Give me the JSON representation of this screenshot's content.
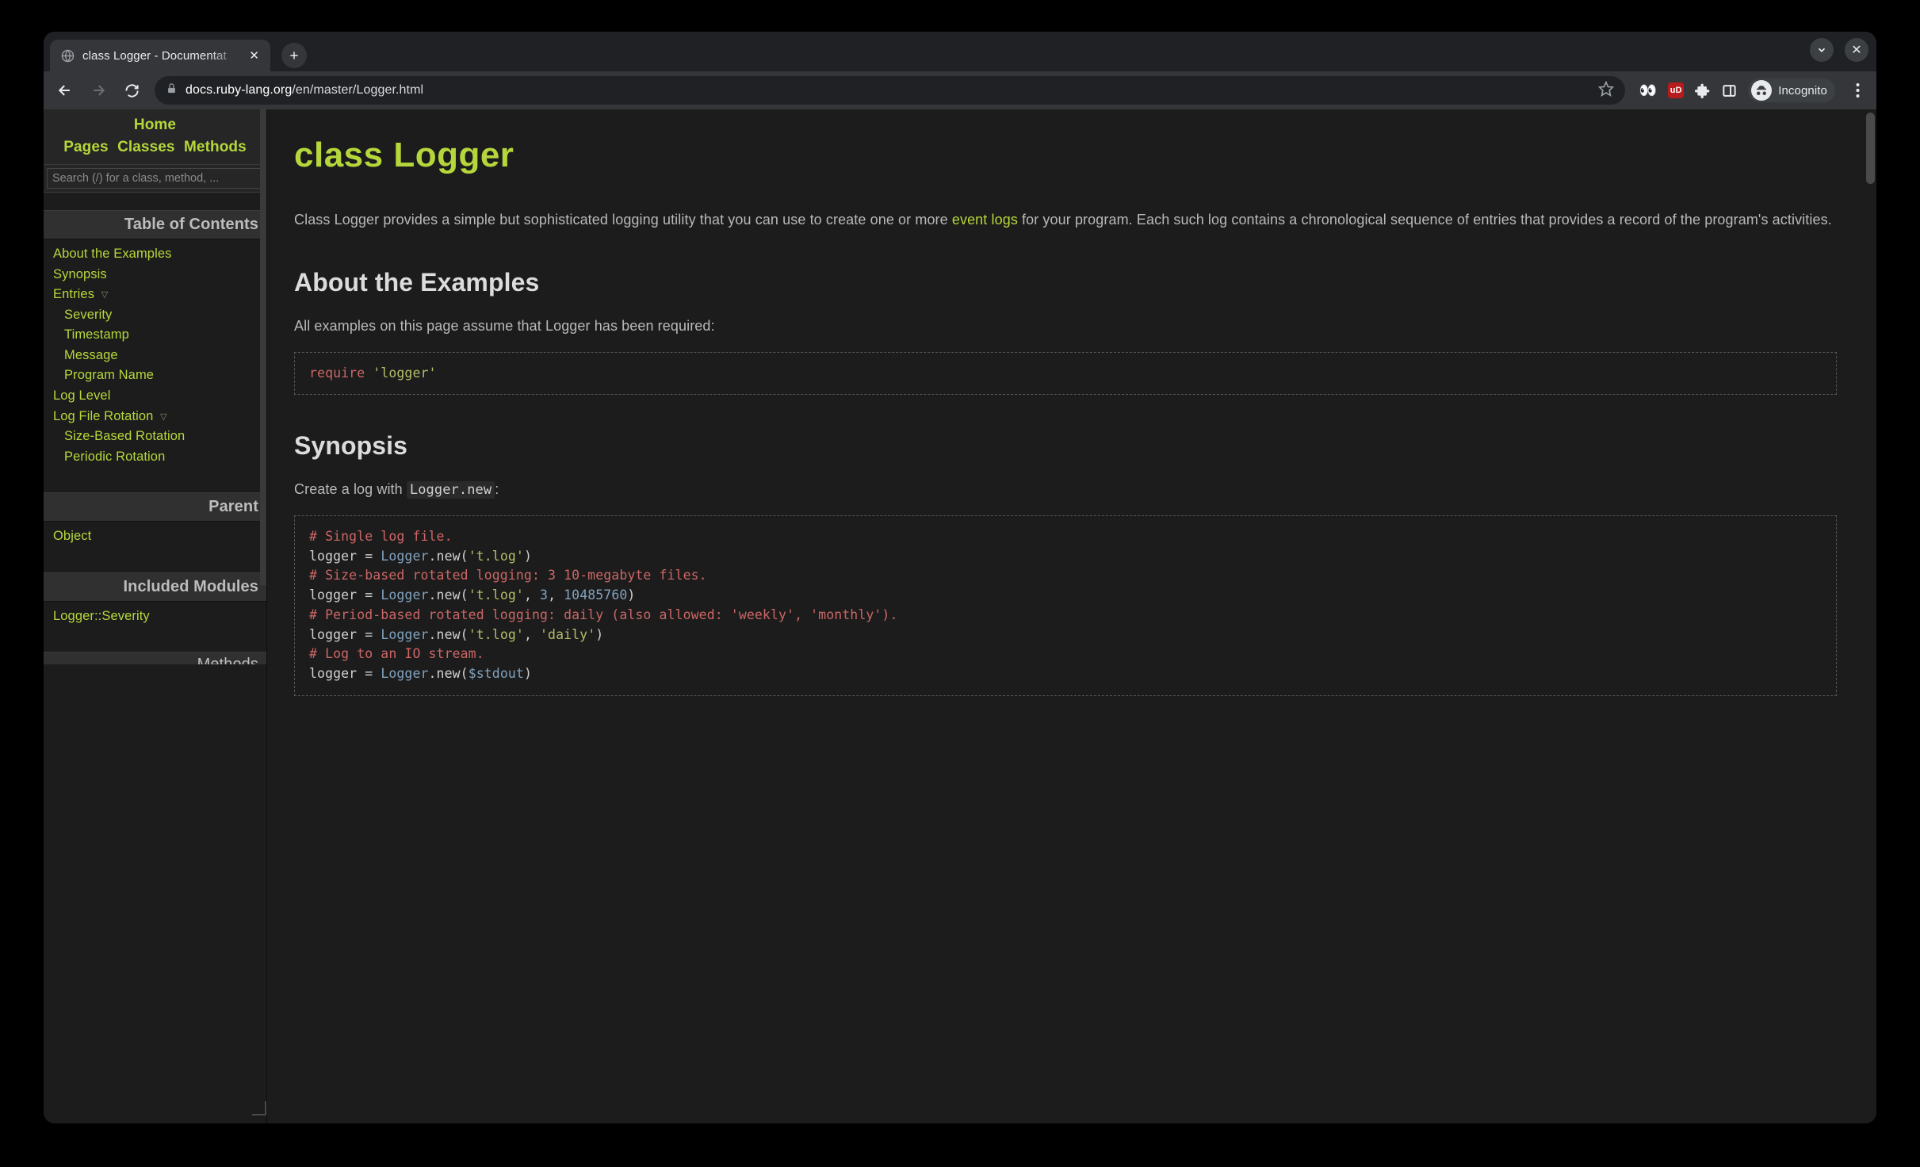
{
  "browser": {
    "tab_title": "class Logger - Documentat",
    "incognito_label": "Incognito",
    "url_domain": "docs.ruby-lang.org",
    "url_path": "/en/master/Logger.html"
  },
  "sidebar": {
    "home": "Home",
    "pages": "Pages",
    "classes": "Classes",
    "methods": "Methods",
    "search_placeholder": "Search (/) for a class, method, ...",
    "toc_heading": "Table of Contents",
    "toc": {
      "about": "About the Examples",
      "synopsis": "Synopsis",
      "entries": "Entries",
      "severity": "Severity",
      "timestamp": "Timestamp",
      "message": "Message",
      "program_name": "Program Name",
      "log_level": "Log Level",
      "log_file_rotation": "Log File Rotation",
      "size_based": "Size-Based Rotation",
      "periodic": "Periodic Rotation"
    },
    "parent_heading": "Parent",
    "parent_link": "Object",
    "modules_heading": "Included Modules",
    "module_link": "Logger::Severity",
    "methods_heading": "Methods"
  },
  "article": {
    "h1": "class Logger",
    "intro_before": "Class Logger provides a simple but sophisticated logging utility that you can use to create one or more ",
    "intro_link": "event logs",
    "intro_after": " for your program. Each such log contains a chronological sequence of entries that provides a record of the program's activities.",
    "about_h2": "About the Examples",
    "about_p": "All examples on this page assume that Logger has been required:",
    "require_kw": "require",
    "require_str": "'logger'",
    "synopsis_h2": "Synopsis",
    "syn_p_before": "Create a log with ",
    "syn_code": "Logger.new",
    "syn_p_after": ":",
    "code2": {
      "c1": "# Single log file.",
      "l1a": "logger = ",
      "l1b": "Logger",
      "l1c": ".new(",
      "l1d": "'t.log'",
      "l1e": ")",
      "c2": "# Size-based rotated logging: 3 10-megabyte files.",
      "l2a": "logger = ",
      "l2b": "Logger",
      "l2c": ".new(",
      "l2d": "'t.log'",
      "l2e": ", ",
      "l2f": "3",
      "l2g": ", ",
      "l2h": "10485760",
      "l2i": ")",
      "c3": "# Period-based rotated logging: daily (also allowed: 'weekly', 'monthly').",
      "l3a": "logger = ",
      "l3b": "Logger",
      "l3c": ".new(",
      "l3d": "'t.log'",
      "l3e": ", ",
      "l3f": "'daily'",
      "l3g": ")",
      "c4": "# Log to an IO stream.",
      "l4a": "logger = ",
      "l4b": "Logger",
      "l4c": ".new(",
      "l4d": "$stdout",
      "l4e": ")"
    }
  }
}
